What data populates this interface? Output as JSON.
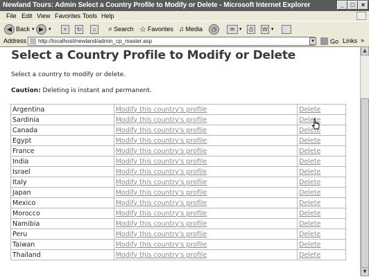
{
  "window": {
    "title": "Newland Tours: Admin Select a Country Profile to Modify or Delete - Microsoft Internet Explorer",
    "btn_min": "_",
    "btn_max": "□",
    "btn_close": "×"
  },
  "menu": [
    "File",
    "Edit",
    "View",
    "Favorites",
    "Tools",
    "Help"
  ],
  "toolbar": {
    "back": "Back",
    "search": "Search",
    "favorites": "Favorites",
    "media": "Media"
  },
  "address": {
    "label": "Address",
    "url": "http://localhost/newland/admin_cp_master.asp",
    "go": "Go",
    "links": "Links",
    "links_chevron": "»"
  },
  "page": {
    "heading": "Select a Country Profile to Modify or Delete",
    "intro": "Select a country to modify or delete.",
    "caution_label": "Caution:",
    "caution_text": " Deleting is instant and permanent."
  },
  "countries": [
    {
      "name": "Argentina",
      "modify": "Modify this country's profile",
      "delete": "Delete"
    },
    {
      "name": "Sardinia",
      "modify": "Modify this country's profile",
      "delete": "Delete"
    },
    {
      "name": "Canada",
      "modify": "Modify this country's profile",
      "delete": "Delete"
    },
    {
      "name": "Egypt",
      "modify": "Modify this country's profile",
      "delete": "Delete"
    },
    {
      "name": "France",
      "modify": "Modify this country's profile",
      "delete": "Delete"
    },
    {
      "name": "India",
      "modify": "Modify this country's profile",
      "delete": "Delete"
    },
    {
      "name": "Israel",
      "modify": "Modify this country's profile",
      "delete": "Delete"
    },
    {
      "name": "Italy",
      "modify": "Modify this country's profile",
      "delete": "Delete"
    },
    {
      "name": "Japan",
      "modify": "Modify this country's profile",
      "delete": "Delete"
    },
    {
      "name": "Mexico",
      "modify": "Modify this country's profile",
      "delete": "Delete"
    },
    {
      "name": "Morocco",
      "modify": "Modify this country's profile",
      "delete": "Delete"
    },
    {
      "name": "Namibia",
      "modify": "Modify this country's profile",
      "delete": "Delete"
    },
    {
      "name": "Peru",
      "modify": "Modify this country's profile",
      "delete": "Delete"
    },
    {
      "name": "Taiwan",
      "modify": "Modify this country's profile",
      "delete": "Delete"
    },
    {
      "name": "Thailand",
      "modify": "Modify this country's profile",
      "delete": "Delete"
    }
  ],
  "icons": {
    "back": "back-arrow-icon",
    "forward": "forward-arrow-icon",
    "stop": "stop-icon",
    "refresh": "refresh-icon",
    "home": "home-icon",
    "search": "search-icon",
    "favorites": "favorites-star-icon",
    "media": "media-icon",
    "history": "history-icon",
    "mail": "mail-icon",
    "print": "print-icon",
    "edit": "edit-icon",
    "cursor": "hand-pointer-icon"
  }
}
